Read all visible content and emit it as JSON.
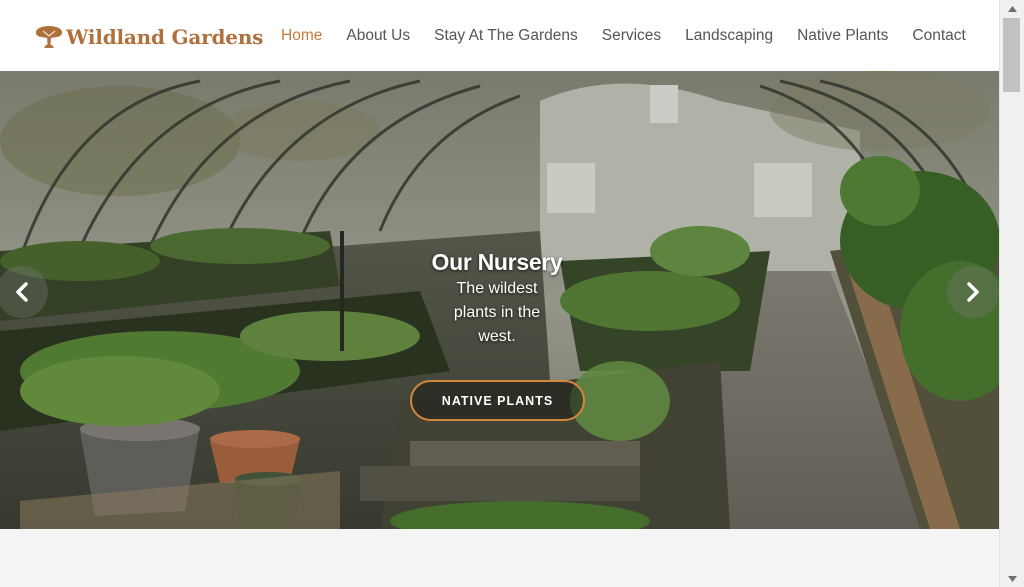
{
  "header": {
    "logo_text": "Wildland Gardens",
    "logo_icon": "tree-icon",
    "brand_color": "#b0703c"
  },
  "nav": {
    "items": [
      {
        "label": "Home",
        "active": true
      },
      {
        "label": "About Us",
        "active": false
      },
      {
        "label": "Stay At The Gardens",
        "active": false
      },
      {
        "label": "Services",
        "active": false
      },
      {
        "label": "Landscaping",
        "active": false
      },
      {
        "label": "Native Plants",
        "active": false
      },
      {
        "label": "Contact",
        "active": false
      }
    ],
    "active_color": "#c57a3c",
    "text_color": "#555555"
  },
  "hero": {
    "title": "Our Nursery",
    "subtitle": "The wildest plants in the west.",
    "button_label": "NATIVE PLANTS",
    "button_border_color": "#d2873d",
    "prev_icon": "chevron-left-icon",
    "next_icon": "chevron-right-icon"
  }
}
